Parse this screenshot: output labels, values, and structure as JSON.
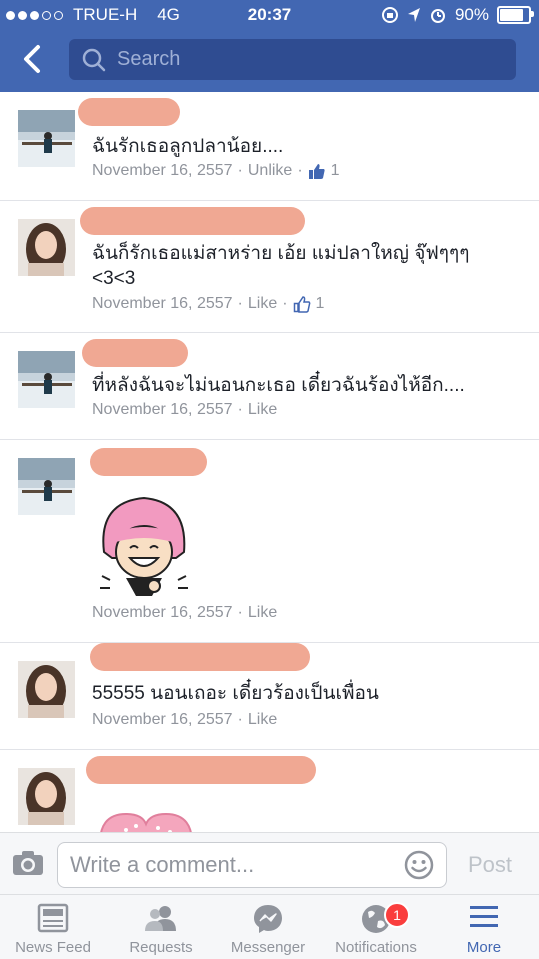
{
  "status": {
    "carrier": "TRUE-H",
    "network": "4G",
    "time": "20:37",
    "battery": "90%",
    "battery_level": 0.9
  },
  "header": {
    "search_placeholder": "Search"
  },
  "comments": [
    {
      "text": "ฉันรักเธอลูกปลาน้อย....",
      "date": "November 16, 2557",
      "action": "Unlike",
      "likes": "1"
    },
    {
      "text": "ฉันก็รักเธอแม่สาหร่าย เอ้ย แม่ปลาใหญ่ จุ๊ฟๆๆๆ <3<3",
      "date": "November 16, 2557",
      "action": "Like",
      "likes": "1"
    },
    {
      "text": "ที่หลังฉันจะไม่นอนกะเธอ เดี๋ยวฉันร้องไห้อีก....",
      "date": "November 16, 2557",
      "action": "Like"
    },
    {
      "text": "",
      "date": "November 16, 2557",
      "action": "Like"
    },
    {
      "text": "55555 นอนเถอะ  เดี๋ยวร้องเป็นเพื่อน",
      "date": "November 16, 2557",
      "action": "Like"
    }
  ],
  "composer": {
    "placeholder": "Write a comment...",
    "post_label": "Post"
  },
  "tabs": [
    {
      "label": "News Feed"
    },
    {
      "label": "Requests"
    },
    {
      "label": "Messenger"
    },
    {
      "label": "Notifications",
      "badge": "1"
    },
    {
      "label": "More"
    }
  ],
  "colors": {
    "brand": "#4267b2",
    "header_search": "#2f4c91",
    "badge": "#fa3e3e",
    "meta": "#90949c"
  }
}
